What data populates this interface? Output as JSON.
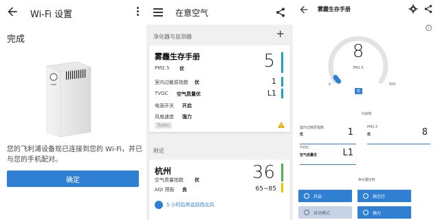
{
  "wifi_setup": {
    "title": "Wi-Fi 设置",
    "heading": "完成",
    "description": "您的飞利浦设备现已连接到您的 Wi-Fi，并已与您的手机配对。",
    "confirm_label": "确定"
  },
  "air_list": {
    "title": "在意空气",
    "section_devices": "净化器与监测器",
    "section_nearby": "附近",
    "device_card": {
      "name": "雾霾生存手册",
      "value": "5",
      "rows": [
        {
          "label": "PM2.5",
          "value": "优",
          "num": ""
        },
        {
          "label": "室内过敏原指数",
          "value": "优",
          "num": "1"
        },
        {
          "label": "TVOC",
          "value": "空气质量优",
          "num": "L1"
        },
        {
          "label": "电源开关",
          "value": "开启",
          "num": ""
        },
        {
          "label": "风扇速度",
          "value": "强力",
          "num": ""
        }
      ],
      "tag": "Turbo"
    },
    "city_card": {
      "name": "杭州",
      "value": "36",
      "rows": [
        {
          "label": "空气质量指数",
          "value": "优",
          "num": ""
        },
        {
          "label": "AQI 预报",
          "value": "良",
          "num": "65~85"
        }
      ],
      "forecast": "5 小时后将会刮西北风"
    }
  },
  "device_detail": {
    "title": "雾霾生存手册",
    "gauge_value": "8",
    "gauge_label": "PM2.5",
    "gauge_min": "0",
    "gauge_max": "500",
    "gauge_badge": "优",
    "gauge_level": 0.016,
    "section_pollutants": "污染物",
    "section_controls": "净化器控制",
    "metrics": [
      {
        "label": "室内过敏原指数",
        "sub": "优",
        "num": "1"
      },
      {
        "label": "PM2.5",
        "sub": "优",
        "num": "8"
      },
      {
        "label": "TVOC",
        "sub": "空气质量优",
        "num": "L1"
      }
    ],
    "controls": [
      {
        "label": "开启",
        "active": true
      },
      {
        "label": "指示灯",
        "active": true
      },
      {
        "label": "自动模式",
        "active": false
      },
      {
        "label": "强力",
        "active": true
      }
    ]
  },
  "colors": {
    "accent": "#2f7fd3",
    "teal": "#1aa3b5",
    "green": "#4caf50",
    "yellow": "#e6c200"
  }
}
